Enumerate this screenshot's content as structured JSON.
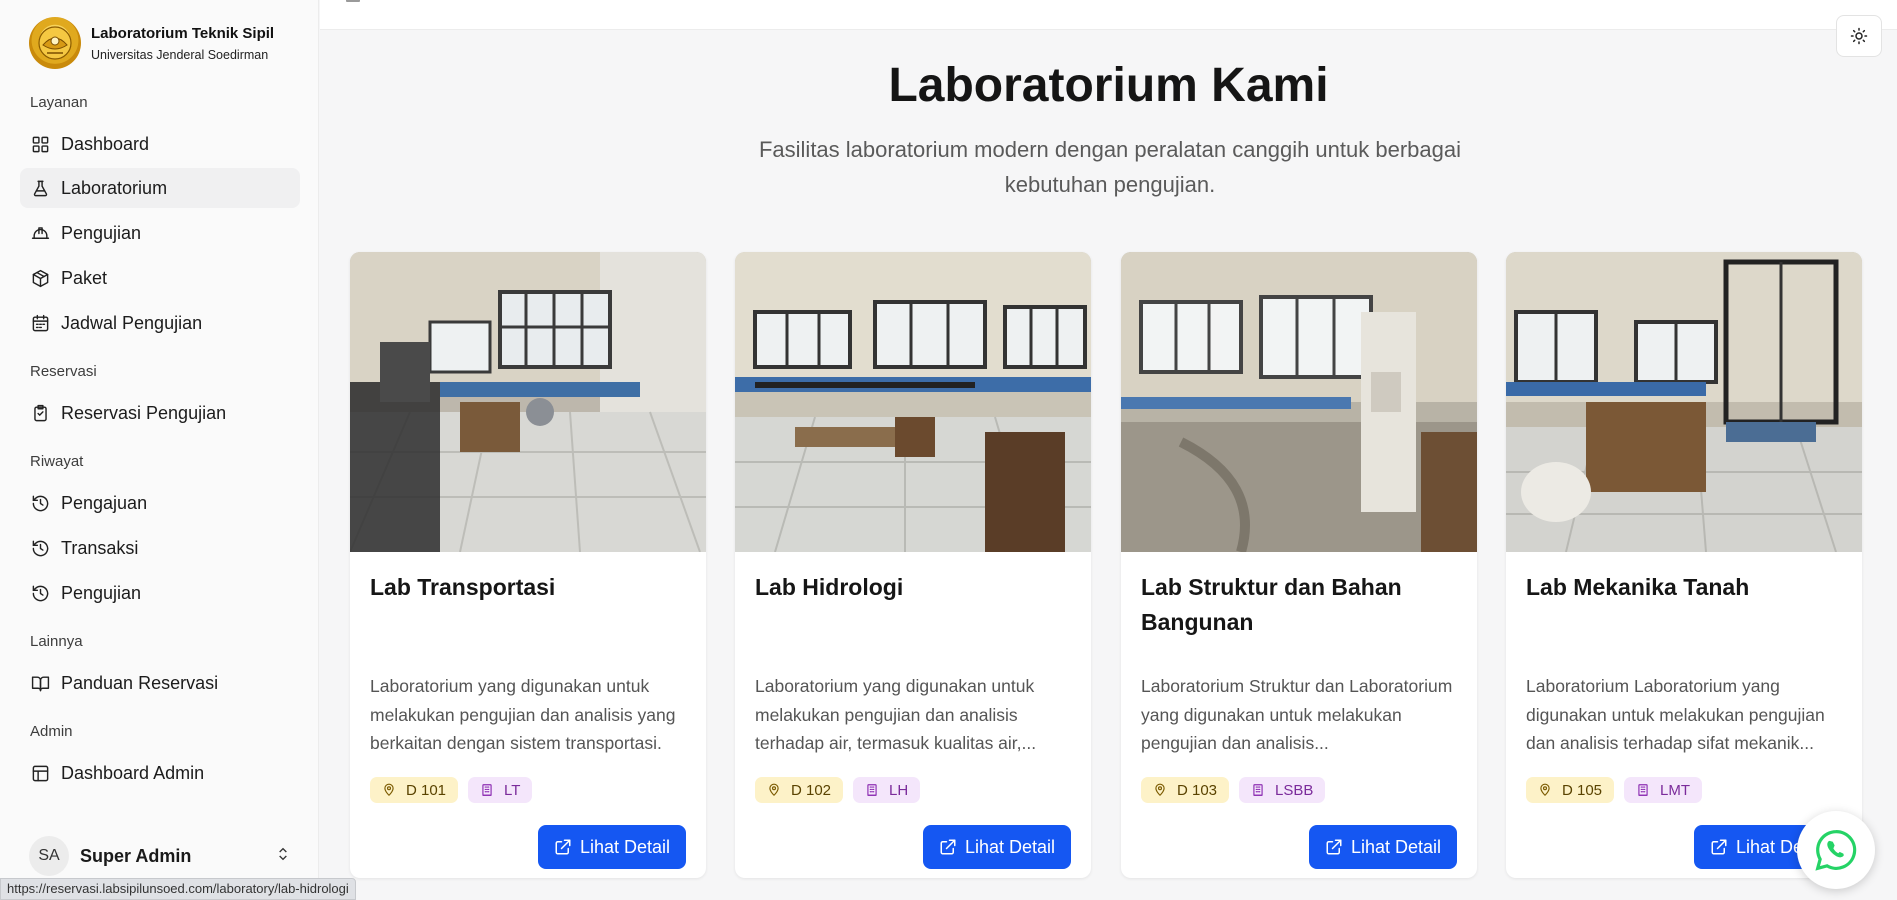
{
  "brand": {
    "title": "Laboratorium Teknik Sipil",
    "subtitle": "Universitas Jenderal Soedirman"
  },
  "sidebar": {
    "sections": [
      {
        "label": "Layanan"
      },
      {
        "label": "Reservasi"
      },
      {
        "label": "Riwayat"
      },
      {
        "label": "Lainnya"
      },
      {
        "label": "Admin"
      }
    ],
    "items": [
      {
        "label": "Dashboard",
        "icon": "grid-icon"
      },
      {
        "label": "Laboratorium",
        "icon": "flask-icon",
        "active": true
      },
      {
        "label": "Pengujian",
        "icon": "hard-hat-icon"
      },
      {
        "label": "Paket",
        "icon": "package-icon"
      },
      {
        "label": "Jadwal Pengujian",
        "icon": "calendar-icon"
      },
      {
        "label": "Reservasi Pengujian",
        "icon": "clipboard-icon"
      },
      {
        "label": "Pengajuan",
        "icon": "history-icon"
      },
      {
        "label": "Transaksi",
        "icon": "history-icon"
      },
      {
        "label": "Pengujian",
        "icon": "history-icon"
      },
      {
        "label": "Panduan Reservasi",
        "icon": "book-open-icon"
      },
      {
        "label": "Dashboard Admin",
        "icon": "layout-icon"
      }
    ],
    "user": {
      "initials": "SA",
      "name": "Super Admin"
    }
  },
  "main": {
    "title": "Laboratorium Kami",
    "subtitle": "Fasilitas laboratorium modern dengan peralatan canggih untuk berbagai kebutuhan pengujian.",
    "cards": [
      {
        "title": "Lab Transportasi",
        "description": "Laboratorium yang digunakan untuk melakukan pengujian dan analisis yang berkaitan dengan sistem transportasi.",
        "room": "D 101",
        "code": "LT",
        "button": "Lihat Detail"
      },
      {
        "title": "Lab Hidrologi",
        "description": "Laboratorium yang digunakan untuk melakukan pengujian dan analisis terhadap air, termasuk kualitas air,...",
        "room": "D 102",
        "code": "LH",
        "button": "Lihat Detail"
      },
      {
        "title": "Lab Struktur dan Bahan Bangunan",
        "description": "Laboratorium Struktur dan Laboratorium yang digunakan untuk melakukan pengujian dan analisis...",
        "room": "D 103",
        "code": "LSBB",
        "button": "Lihat Detail"
      },
      {
        "title": "Lab Mekanika Tanah",
        "description": "Laboratorium Laboratorium yang digunakan untuk melakukan pengujian dan analisis terhadap sifat mekanik...",
        "room": "D 105",
        "code": "LMT",
        "button": "Lihat Detail"
      }
    ]
  },
  "status_url": "https://reservasi.labsipilunsoed.com/laboratory/lab-hidrologi",
  "colors": {
    "primary": "#1557f2",
    "location_badge_bg": "#fdf2c8",
    "code_badge_bg": "#f4e6fb",
    "whatsapp": "#25d366"
  }
}
